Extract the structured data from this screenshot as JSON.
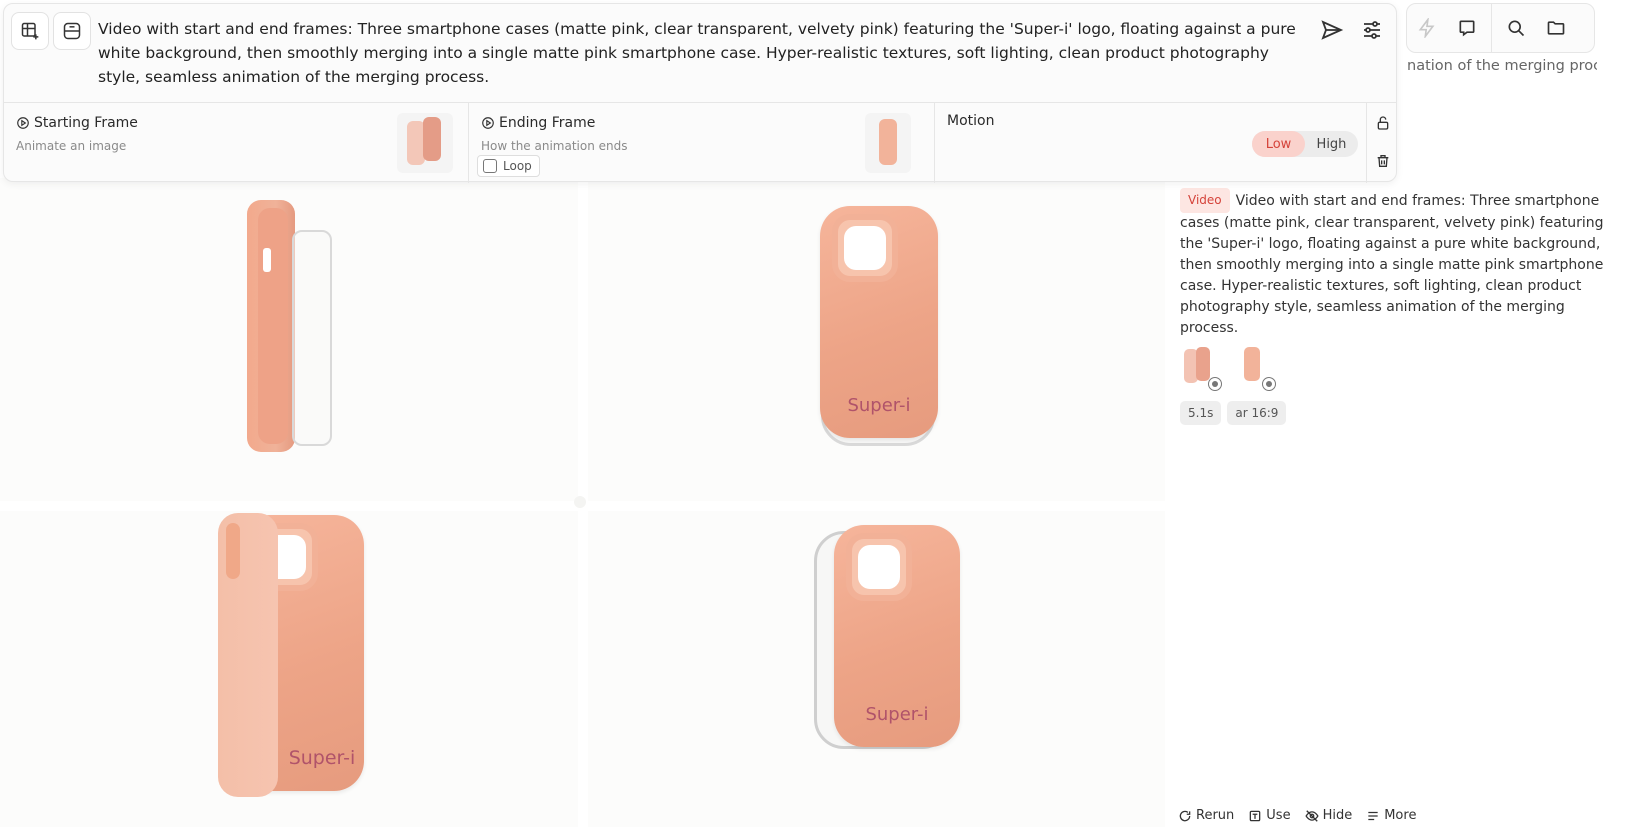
{
  "prompt": {
    "text": "Video with start and end frames: Three smartphone cases (matte pink, clear transparent, velvety pink) featuring the 'Super-i' logo, floating against a pure white background, then smoothly merging into a single matte pink smartphone case. Hyper-realistic textures, soft lighting, clean product photography style, seamless animation of the merging process."
  },
  "frames": {
    "starting": {
      "title": "Starting Frame",
      "subtitle": "Animate an image"
    },
    "ending": {
      "title": "Ending Frame",
      "subtitle": "How the animation ends",
      "loop_label": "Loop"
    },
    "motion": {
      "title": "Motion",
      "low": "Low",
      "high": "High",
      "selected": "Low"
    }
  },
  "grid": {
    "cells": [
      {
        "logo": ""
      },
      {
        "logo": "Super-i"
      },
      {
        "logo": "Super-i"
      },
      {
        "logo": "Super-i"
      }
    ]
  },
  "ghost": {
    "line": "nation of the merging process."
  },
  "info": {
    "badge": "Video",
    "description": "Video with start and end frames: Three smartphone cases (matte pink, clear transparent, velvety pink) featuring the 'Super-i' logo, floating against a pure white background, then smoothly merging into a single matte pink smartphone case. Hyper-realistic textures, soft lighting, clean product photography style, seamless animation of the merging process.",
    "chips": [
      "5.1s",
      "ar 16:9"
    ]
  },
  "actions": {
    "rerun": "Rerun",
    "use": "Use",
    "hide": "Hide",
    "more": "More"
  },
  "colors": {
    "accent": "#d5433a",
    "case_pink": "#eda487"
  }
}
